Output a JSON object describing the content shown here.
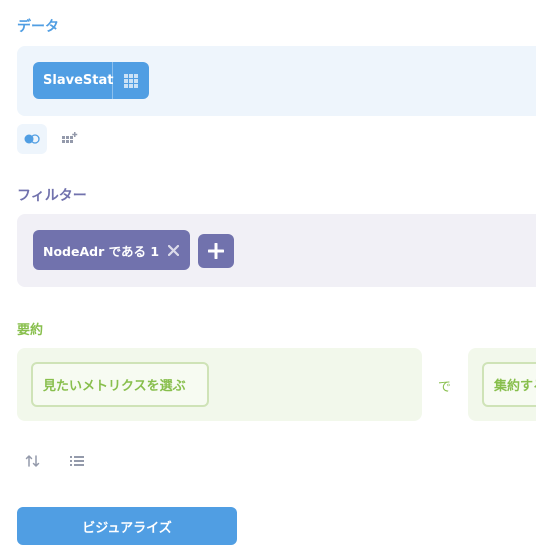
{
  "sections": {
    "data_title": "データ",
    "filter_title": "フィルター",
    "summarize_title": "要約"
  },
  "data_step": {
    "table_name": "SlaveStat",
    "icons": [
      "grid-icon",
      "join-icon",
      "add-column-icon"
    ]
  },
  "filter_step": {
    "filter_label": "NodeAdr である 1",
    "icons": [
      "close-icon",
      "plus-icon"
    ]
  },
  "summarize_step": {
    "metric_placeholder": "見たいメトリクスを選ぶ",
    "by_label": "で",
    "group_placeholder": "集約する",
    "icons": [
      "sort-icon",
      "limit-icon"
    ]
  },
  "actions": {
    "visualize_label": "ビジュアライズ"
  },
  "colors": {
    "data_accent": "#509ee3",
    "filter_accent": "#7172ad",
    "summarize_accent": "#88bf4d"
  }
}
